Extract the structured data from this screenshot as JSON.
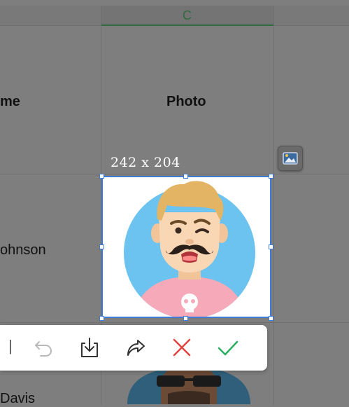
{
  "sheet": {
    "column_c_label": "C",
    "name_header_partial": "me",
    "photo_header": "Photo",
    "row1_name_partial": "ohnson",
    "row2_name_partial": "Davis"
  },
  "image_edit": {
    "size_label": "242 x 204",
    "image_icon": "image-icon"
  },
  "toolbar": {
    "separator": "|",
    "undo_icon": "undo-icon",
    "save_icon": "download-icon",
    "redo_icon": "redo-icon",
    "cancel_icon": "close-icon",
    "confirm_icon": "check-icon"
  },
  "colors": {
    "selection": "#3d7bd5",
    "cancel": "#e0453f",
    "confirm": "#27ae60",
    "active_column": "#2f6b3f"
  }
}
